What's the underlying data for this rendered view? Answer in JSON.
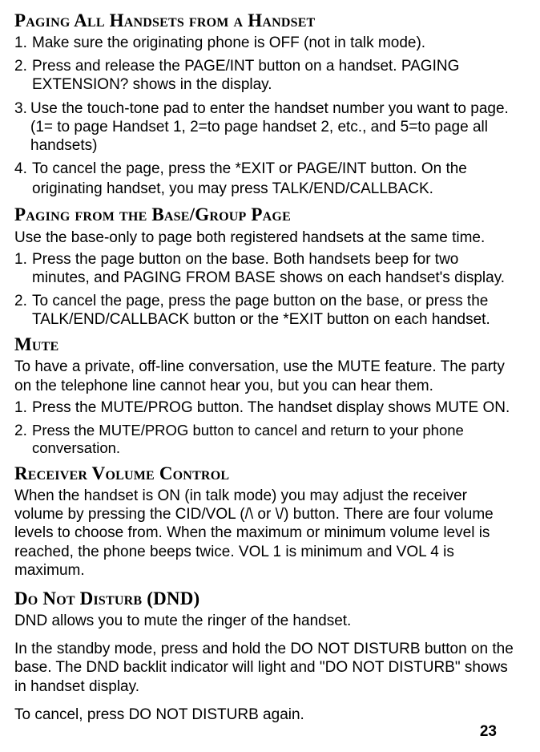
{
  "sections": {
    "s1": {
      "heading": "Paging All Handsets from a Handset",
      "items": {
        "n1": "1.",
        "t1": "Make sure the originating phone is OFF (not in talk mode).",
        "n2": "2.",
        "t2": "Press and release the PAGE/INT button on a handset. PAGING EXTENSION? shows in the display.",
        "n3": "3.",
        "t3": "Use the touch-tone pad to enter the handset number you want to page. (1= to page Handset 1, 2=to page handset 2, etc., and 5=to page all handsets)",
        "n4": "4.",
        "t4": "To cancel the page, press the *EXIT or PAGE/INT button. On the originating handset, you may press TALK/END/CALLBACK."
      }
    },
    "s2": {
      "heading": "Paging from the Base/Group Page",
      "intro": "Use the base-only to page both registered handsets at the same time.",
      "items": {
        "n1": "1.",
        "t1": "Press the page button on the base. Both handsets beep for two minutes, and PAGING FROM BASE shows on each handset's display.",
        "n2": "2.",
        "t2": "To cancel the page, press the page button on the base, or press the TALK/END/CALLBACK button or the *EXIT button on each handset."
      }
    },
    "s3": {
      "heading": "Mute",
      "intro": "To have a private, off-line conversation, use the MUTE feature. The party on the telephone line cannot hear you, but you can hear them.",
      "items": {
        "n1": "1.",
        "t1": "Press the MUTE/PROG button. The handset display shows MUTE ON.",
        "n2": "2.",
        "t2": "Press the MUTE/PROG button to cancel and return to your phone conversation."
      }
    },
    "s4": {
      "heading": "Receiver Volume Control",
      "body": "When the handset is ON (in talk mode) you may adjust the receiver volume by pressing the CID/VOL (/\\ or \\/) button. There are four volume levels to choose from. When the maximum or minimum volume level is reached, the phone beeps twice. VOL 1 is minimum and VOL 4 is maximum."
    },
    "s5": {
      "heading": "Do Not Disturb (DND)",
      "p1": "DND allows you to mute the ringer of the handset.",
      "p2": "In the standby mode, press and hold the DO NOT DISTURB button on the base. The DND backlit indicator will light and \"DO NOT DISTURB\" shows in handset display.",
      "p3": "To cancel, press DO NOT DISTURB again."
    }
  },
  "page_number": "23"
}
